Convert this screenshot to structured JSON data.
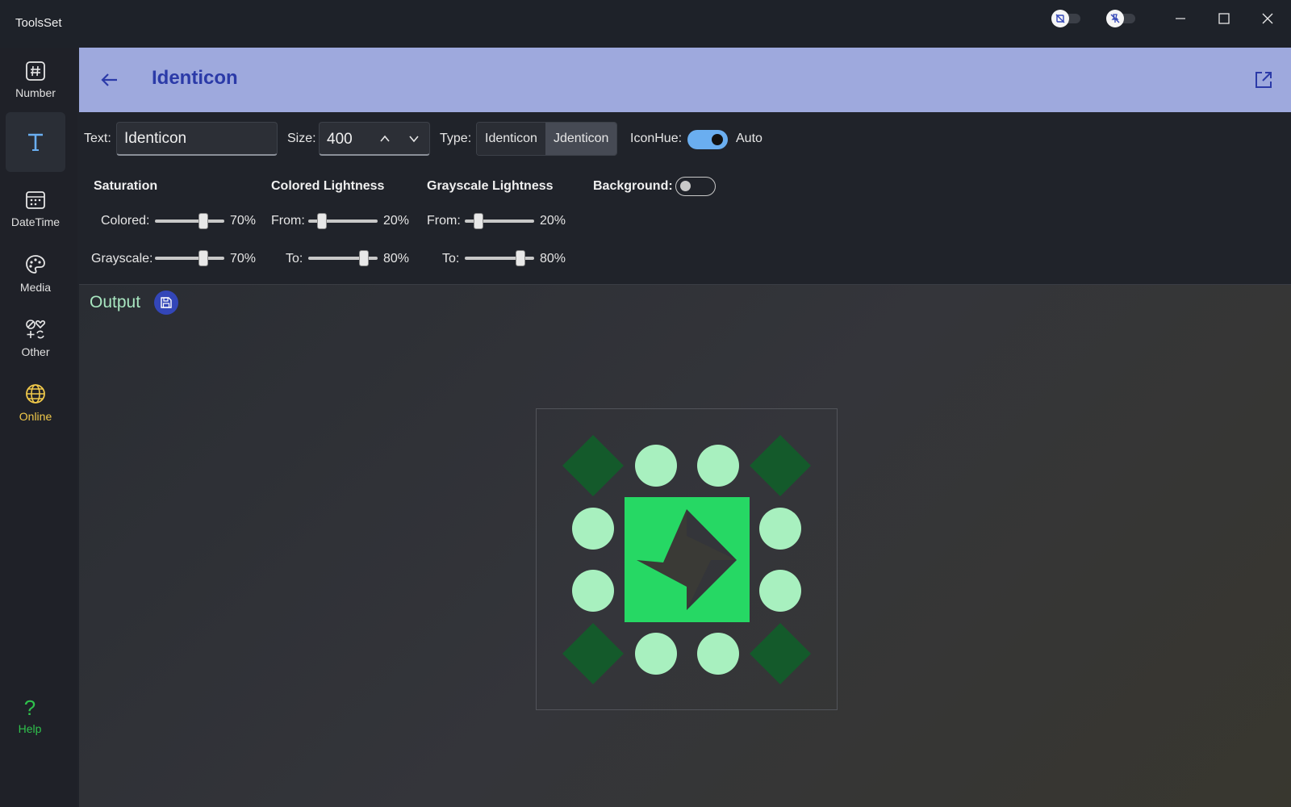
{
  "app": {
    "title": "ToolsSet"
  },
  "titlebar": {
    "toggle_1_icon": "no-camera-icon",
    "toggle_2_icon": "unpin-icon",
    "minimize_icon": "minimize-icon",
    "maximize_icon": "maximize-icon",
    "close_icon": "close-icon"
  },
  "sidebar": {
    "items": [
      {
        "label": "Number",
        "icon": "hash-icon"
      },
      {
        "label": "",
        "icon": "text-icon",
        "active": true
      },
      {
        "label": "DateTime",
        "icon": "calendar-icon"
      },
      {
        "label": "Media",
        "icon": "palette-icon"
      },
      {
        "label": "Other",
        "icon": "shapes-icon"
      },
      {
        "label": "Online",
        "icon": "globe-icon"
      }
    ],
    "help": {
      "glyph": "?",
      "label": "Help"
    }
  },
  "header": {
    "title": "Identicon",
    "back_icon": "back-arrow-icon",
    "open_icon": "open-external-icon"
  },
  "controls": {
    "text_label": "Text:",
    "text_value": "Identicon",
    "size_label": "Size:",
    "size_value": "400",
    "type_label": "Type:",
    "type_options": [
      "Identicon",
      "Jdenticon"
    ],
    "type_selected": "Jdenticon",
    "iconhue_label": "IconHue:",
    "iconhue_on": true,
    "iconhue_text": "Auto",
    "background_label": "Background:",
    "background_on": false
  },
  "saturation": {
    "title": "Saturation",
    "colored_label": "Colored:",
    "colored_value": 0.7,
    "colored_text": "70%",
    "grayscale_label": "Grayscale:",
    "grayscale_value": 0.7,
    "grayscale_text": "70%"
  },
  "colored_lightness": {
    "title": "Colored Lightness",
    "from_label": "From:",
    "from_value": 0.2,
    "from_text": "20%",
    "to_label": "To:",
    "to_value": 0.8,
    "to_text": "80%"
  },
  "grayscale_lightness": {
    "title": "Grayscale Lightness",
    "from_label": "From:",
    "from_value": 0.2,
    "from_text": "20%",
    "to_label": "To:",
    "to_value": 0.8,
    "to_text": "80%"
  },
  "output": {
    "title": "Output",
    "save_icon": "save-icon",
    "colors": {
      "dark": "#145a2b",
      "light": "#a8f0bf",
      "center": "#26d864"
    }
  }
}
